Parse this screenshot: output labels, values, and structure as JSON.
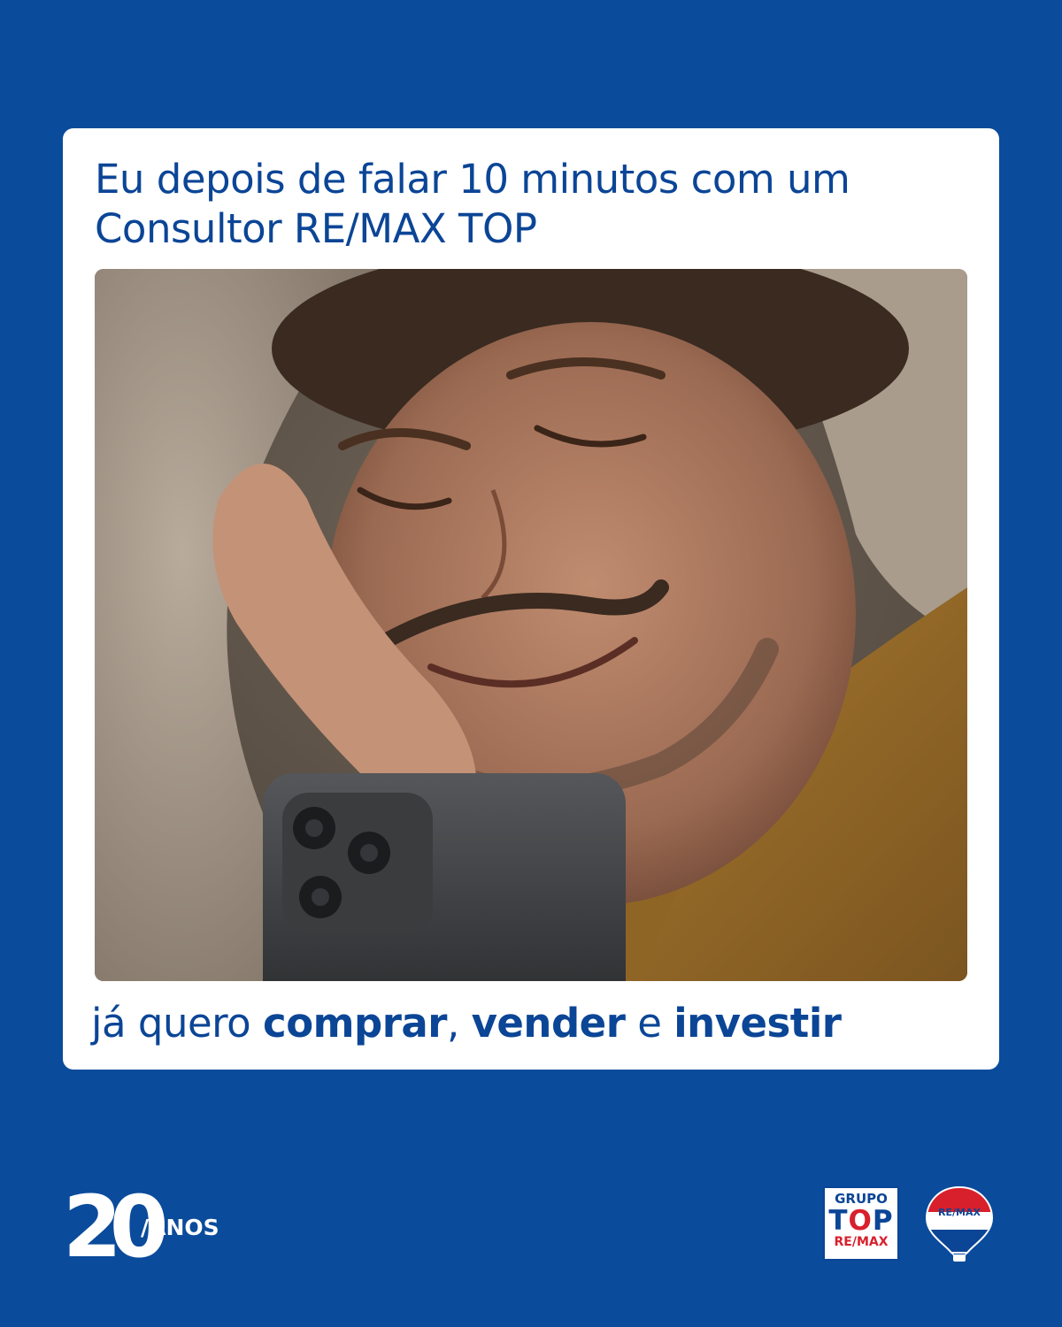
{
  "card": {
    "headline_line1": "Eu depois de falar 10 minutos com um",
    "headline_line2": "Consultor RE/MAX TOP",
    "caption": {
      "prefix": "já quero ",
      "w1": "comprar",
      "sep1": ", ",
      "w2": "vender",
      "sep2": " e ",
      "w3": "investir"
    }
  },
  "footer": {
    "anniversary_number": "20",
    "anniversary_label": "/ANOS",
    "grupo_top": {
      "line1": "GRUPO",
      "line2_a": "T",
      "line2_o": "O",
      "line2_b": "P",
      "line3": "RE/MAX"
    },
    "balloon_label": "RE/MAX"
  },
  "colors": {
    "background": "#0A4B9B",
    "text_blue": "#0B4596",
    "card": "#FFFFFF",
    "brand_red": "#D8202C"
  }
}
